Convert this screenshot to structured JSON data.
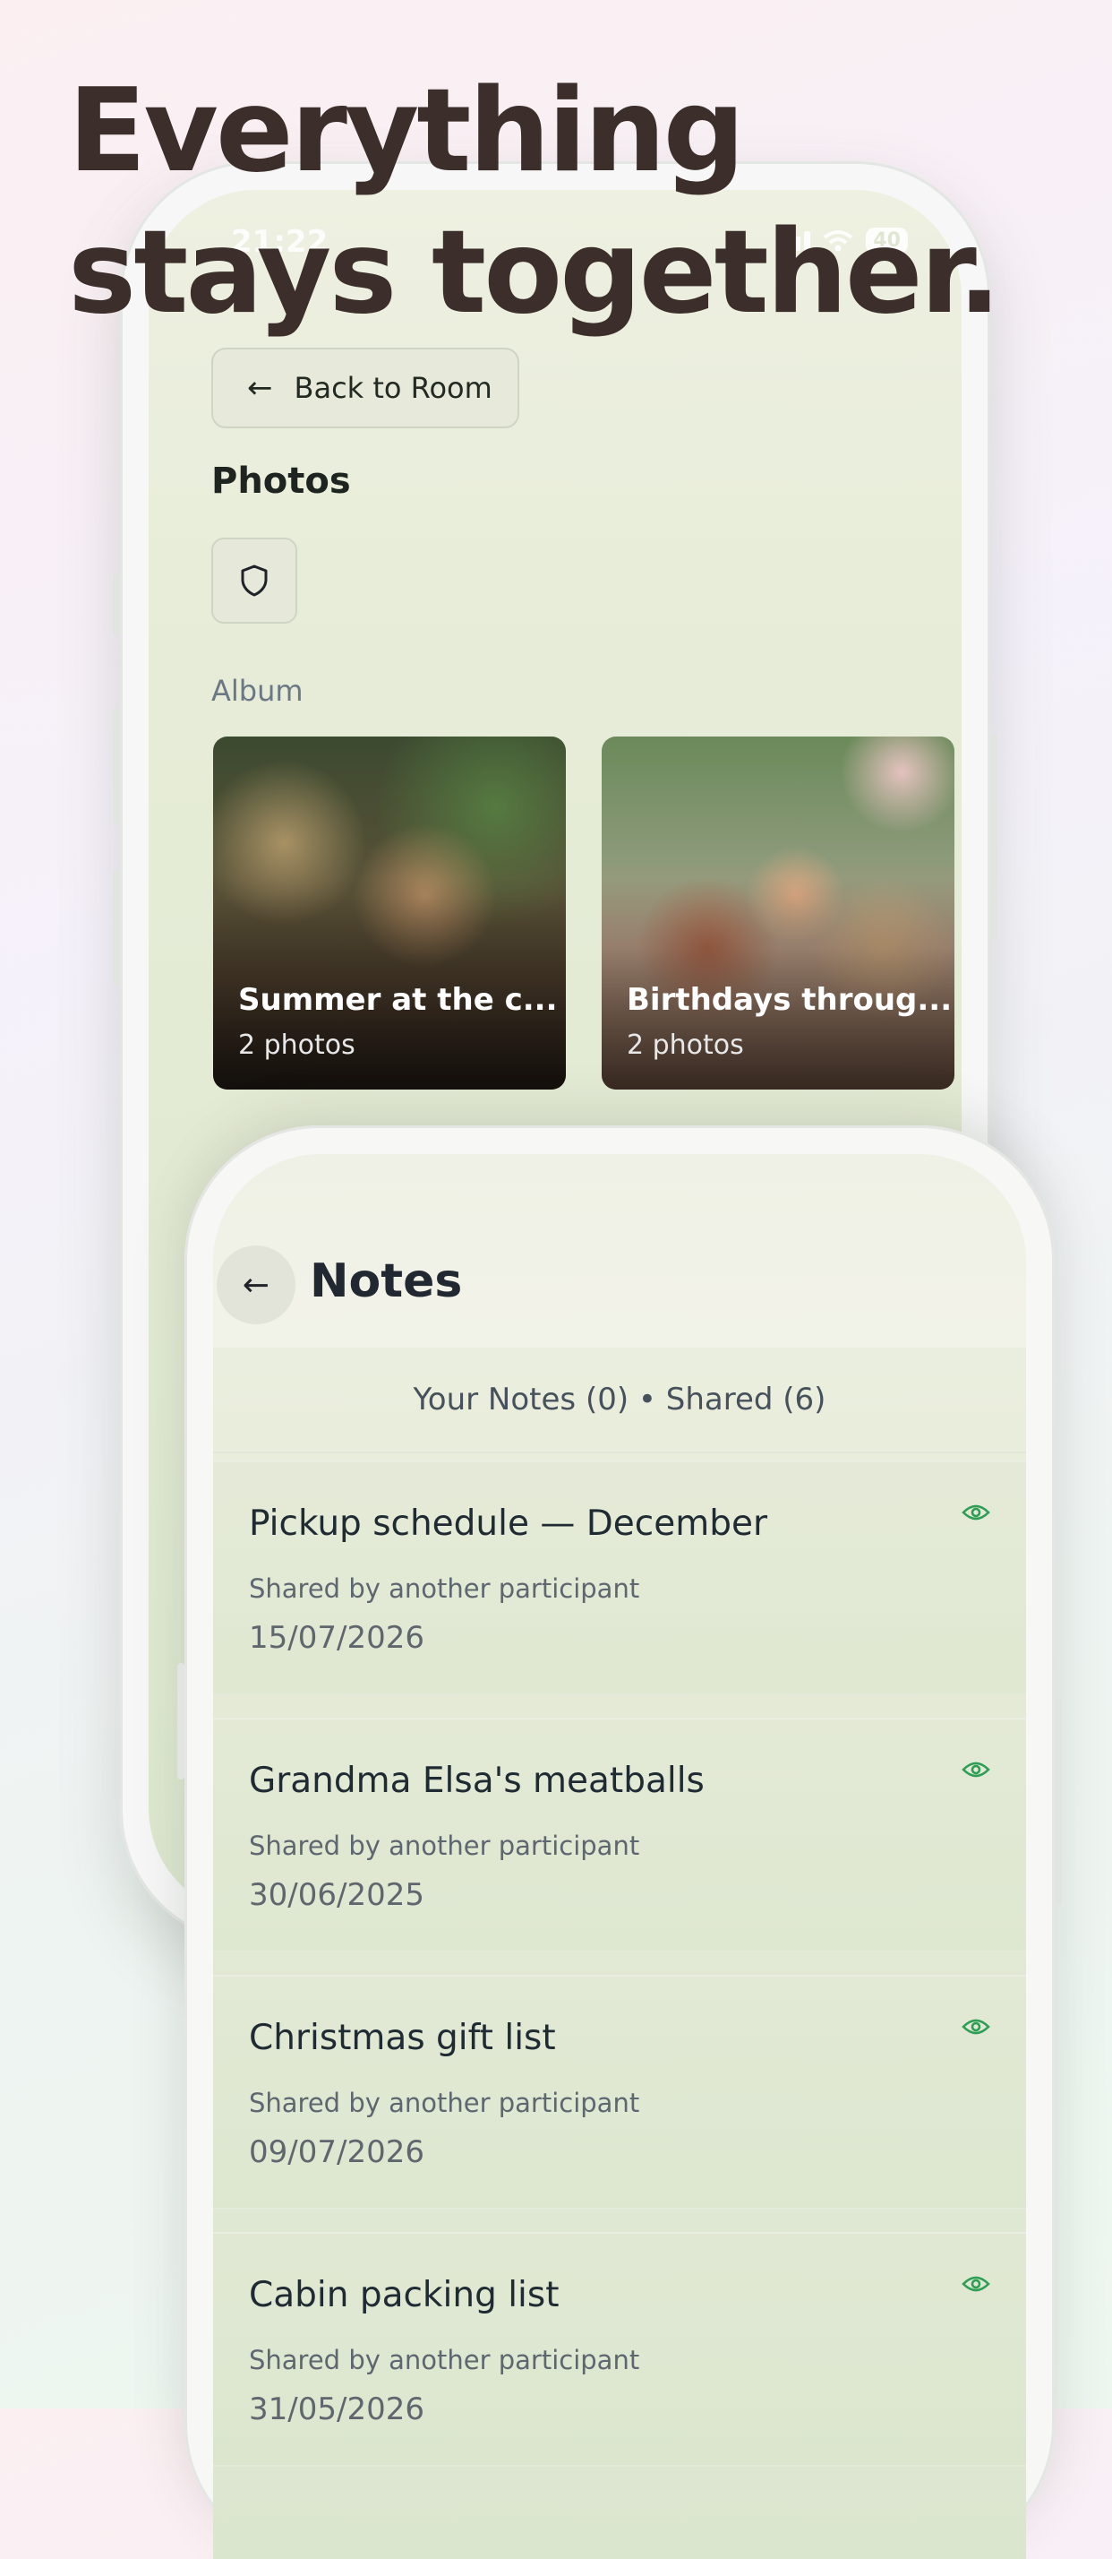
{
  "headline": {
    "line1": "Everything",
    "line2": "stays together."
  },
  "status_bar": {
    "time": "21:22",
    "battery": "40"
  },
  "room": {
    "back_label": "Back to Room",
    "section_title": "Photos",
    "album_label": "Album",
    "albums": [
      {
        "title": "Summer at the c...",
        "count": "2 photos"
      },
      {
        "title": "Birthdays throug...",
        "count": "2 photos"
      }
    ]
  },
  "notes": {
    "title": "Notes",
    "summary": "Your Notes (0) • Shared (6)",
    "items": [
      {
        "title": "Pickup schedule — December",
        "meta": "Shared by another participant",
        "date": "15/07/2026"
      },
      {
        "title": "Grandma Elsa's meatballs",
        "meta": "Shared by another participant",
        "date": "30/06/2025"
      },
      {
        "title": "Christmas gift list",
        "meta": "Shared by another participant",
        "date": "09/07/2026"
      },
      {
        "title": "Cabin packing list",
        "meta": "Shared by another participant",
        "date": "31/05/2026"
      }
    ]
  },
  "colors": {
    "accent_green": "#2e9e55",
    "headline": "#3b2e2b"
  },
  "icons": {
    "back": "arrow-left-icon",
    "shield": "shield-icon",
    "visibility": "eye-icon"
  }
}
